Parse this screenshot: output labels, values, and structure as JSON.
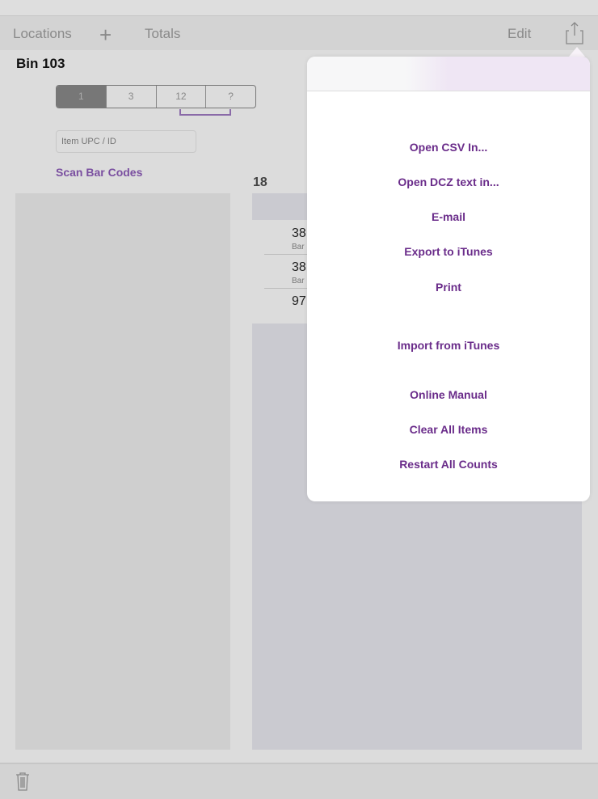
{
  "nav": {
    "locations": "Locations",
    "add_icon": "plus-icon",
    "totals": "Totals",
    "edit": "Edit",
    "share_icon": "share-icon"
  },
  "bin": {
    "title": "Bin 103",
    "segments": [
      "1",
      "3",
      "12",
      "?"
    ],
    "selected_segment": "1",
    "upc_placeholder": "Item UPC / ID",
    "scan": "Scan Bar Codes"
  },
  "list": {
    "count": "18",
    "rows": [
      {
        "value": "38",
        "sub": "Bar"
      },
      {
        "value": "38",
        "sub": "Bar"
      },
      {
        "value": "97",
        "sub": ""
      }
    ]
  },
  "menu": {
    "items": [
      "Open CSV In...",
      "Open DCZ text in...",
      "E-mail",
      "Export to iTunes",
      "Print",
      "Import from iTunes",
      "Online Manual",
      "Clear All Items",
      "Restart All Counts"
    ]
  },
  "bottom": {
    "trash_icon": "trash-icon"
  },
  "colors": {
    "accent": "#6a2c8a"
  }
}
